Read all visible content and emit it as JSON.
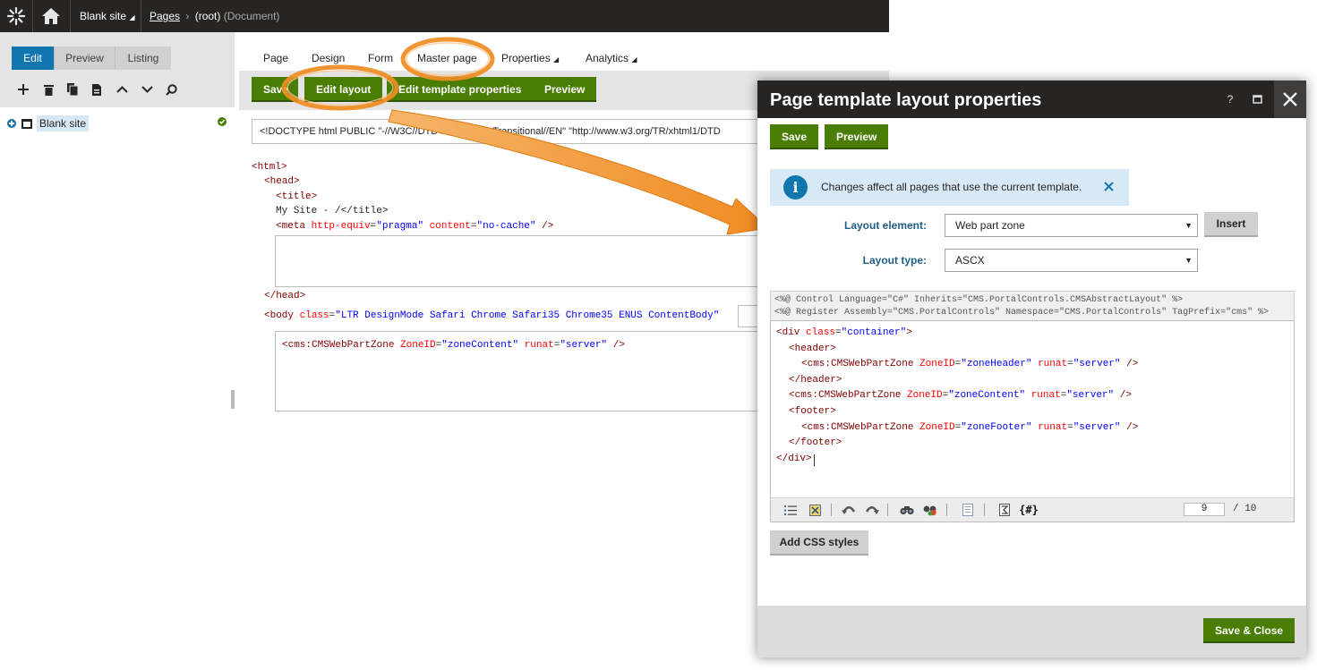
{
  "topbar": {
    "site_selector": "Blank site",
    "breadcrumb_link": "Pages",
    "breadcrumb_current": "(root)",
    "breadcrumb_type": "(Document)",
    "colors": {
      "background": "#262524"
    },
    "icons": [
      "kentico-logo-icon",
      "home-icon",
      "caret-down-icon",
      "chevron-right-icon"
    ]
  },
  "left_panel": {
    "modes": [
      "Edit",
      "Preview",
      "Listing"
    ],
    "active_mode": "Edit",
    "toolbar_icons": [
      "add-icon",
      "delete-icon",
      "copy-icon",
      "move-icon",
      "up-icon",
      "down-icon",
      "search-icon"
    ],
    "tree": {
      "root_label": "Blank site",
      "status": "published"
    }
  },
  "main": {
    "tabs": [
      "Page",
      "Design",
      "Form",
      "Master page",
      "Properties",
      "Analytics"
    ],
    "active_tab": "Master page",
    "toolbar": {
      "save_label": "Save",
      "edit_layout_label": "Edit layout",
      "edit_template_label": "Edit template properties",
      "preview_label": "Preview"
    },
    "doctype": "<!DOCTYPE html PUBLIC \"-//W3C//DTD XHTML 1.0 Transitional//EN\" \"http://www.w3.org/TR/xhtml1/DTD",
    "code": {
      "html_open": "<html>",
      "head_open": "<head>",
      "title_open": "<title>",
      "title_text": "My Site - /</title>",
      "meta_tag": "<meta",
      "meta_attr1": "http-equiv",
      "meta_val1": "\"pragma\"",
      "meta_attr2": "content",
      "meta_val2": "\"no-cache\"",
      "meta_close": "/>",
      "head_close": "</head>",
      "body_tag": "<body",
      "body_attr": "class",
      "body_val": "\"LTR DesignMode Safari Chrome Safari35 Chrome35 ENUS ContentBody\"",
      "zone_tag": "<cms:CMSWebPartZone",
      "zone_attr1": "ZoneID",
      "zone_val1": "\"zoneContent\"",
      "zone_attr2": "runat",
      "zone_val2": "\"server\"",
      "zone_close": "/>"
    }
  },
  "dialog": {
    "title": "Page template layout properties",
    "controls": {
      "help": "?",
      "maximize": "maximize-icon",
      "close": "close-icon"
    },
    "save_label": "Save",
    "preview_label": "Preview",
    "info_text": "Changes affect all pages that use the current template.",
    "layout_element_label": "Layout element:",
    "layout_element_value": "Web part zone",
    "insert_label": "Insert",
    "layout_type_label": "Layout type:",
    "layout_type_value": "ASCX",
    "directive_line1": "<%@ Control Language=\"C#\" Inherits=\"CMS.PortalControls.CMSAbstractLayout\" %>",
    "directive_line2": "<%@ Register Assembly=\"CMS.PortalControls\" Namespace=\"CMS.PortalControls\" TagPrefix=\"cms\" %>",
    "editor_lines": [
      {
        "indent": "",
        "tag": "<div",
        "attr": "class",
        "val": "\"container\"",
        "end": ">"
      },
      {
        "indent": "  ",
        "tag": "<header>",
        "attr": "",
        "val": "",
        "end": ""
      },
      {
        "indent": "    ",
        "tag": "<cms:CMSWebPartZone",
        "attr": "ZoneID",
        "val": "\"zoneHeader\"",
        "attr2": "runat",
        "val2": "\"server\"",
        "end": "/>"
      },
      {
        "indent": "  ",
        "tag": "</header>",
        "attr": "",
        "val": "",
        "end": ""
      },
      {
        "indent": "  ",
        "tag": "<cms:CMSWebPartZone",
        "attr": "ZoneID",
        "val": "\"zoneContent\"",
        "attr2": "runat",
        "val2": "\"server\"",
        "end": "/>"
      },
      {
        "indent": "  ",
        "tag": "<footer>",
        "attr": "",
        "val": "",
        "end": ""
      },
      {
        "indent": "    ",
        "tag": "<cms:CMSWebPartZone",
        "attr": "ZoneID",
        "val": "\"zoneFooter\"",
        "attr2": "runat",
        "val2": "\"server\"",
        "end": "/>"
      },
      {
        "indent": "  ",
        "tag": "</footer>",
        "attr": "",
        "val": "",
        "end": ""
      },
      {
        "indent": "",
        "tag": "</div>",
        "attr": "",
        "val": "",
        "end": ""
      }
    ],
    "line_current": "9",
    "line_total": "/ 10",
    "add_css_label": "Add CSS styles",
    "save_close_label": "Save & Close",
    "colors": {
      "green": "#497d04",
      "info": "#d7e9f6",
      "title_bar": "#262524",
      "highlight": "#f08c22"
    }
  }
}
